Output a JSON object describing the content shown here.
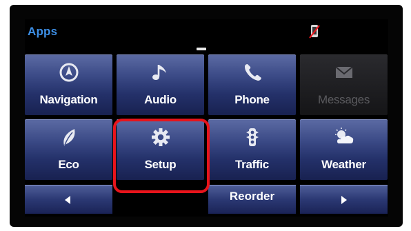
{
  "header": {
    "title": "Apps"
  },
  "status": {
    "phone_icon": "phone-disconnected-icon"
  },
  "tiles": [
    {
      "label": "Navigation",
      "icon": "compass-icon",
      "enabled": true
    },
    {
      "label": "Audio",
      "icon": "music-note-icon",
      "enabled": true
    },
    {
      "label": "Phone",
      "icon": "phone-handset-icon",
      "enabled": true
    },
    {
      "label": "Messages",
      "icon": "envelope-icon",
      "enabled": false
    },
    {
      "label": "Eco",
      "icon": "leaf-icon",
      "enabled": true
    },
    {
      "label": "Setup",
      "icon": "gear-icon",
      "enabled": true,
      "highlighted": true
    },
    {
      "label": "Traffic",
      "icon": "traffic-light-icon",
      "enabled": true
    },
    {
      "label": "Weather",
      "icon": "sun-cloud-icon",
      "enabled": true
    }
  ],
  "footer": {
    "reorder_label": "Reorder",
    "prev_icon": "arrow-left-icon",
    "next_icon": "arrow-right-icon"
  },
  "colors": {
    "accent": "#3d8fe6",
    "tile": "#2b3873",
    "highlight": "#e8141b"
  }
}
